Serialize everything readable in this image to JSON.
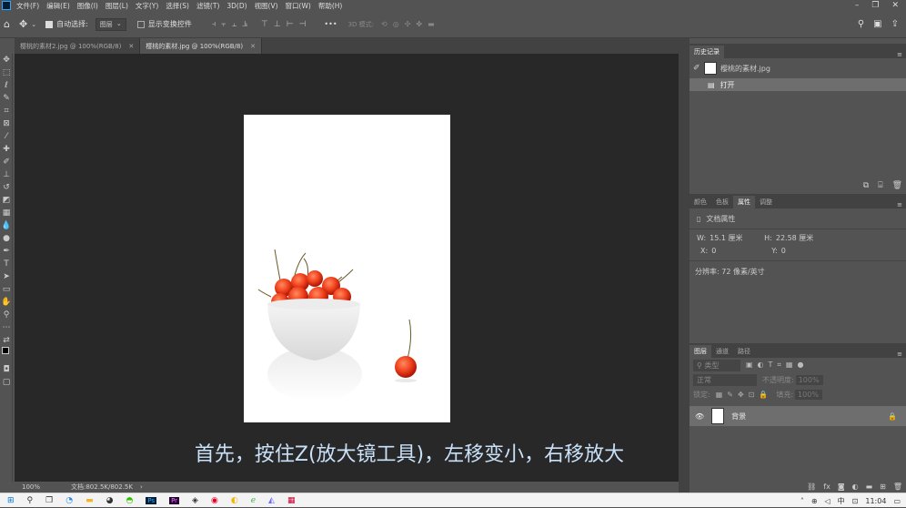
{
  "menu": [
    "文件(F)",
    "编辑(E)",
    "图像(I)",
    "图层(L)",
    "文字(Y)",
    "选择(S)",
    "滤镜(T)",
    "3D(D)",
    "视图(V)",
    "窗口(W)",
    "帮助(H)"
  ],
  "options": {
    "auto_select_label": "自动选择:",
    "auto_select_value": "图层",
    "show_transform_label": "显示变换控件",
    "mode_3d": "3D 模式:"
  },
  "doc_tabs": [
    {
      "label": "樱桃的素材2.jpg @ 100%(RGB/8)",
      "active": false
    },
    {
      "label": "樱桃的素材.jpg @ 100%(RGB/8)",
      "active": true
    }
  ],
  "caption": "首先，按住Z(放大镜工具)，左移变小，右移放大",
  "status": {
    "zoom": "100%",
    "doc_info": "文档:802.5K/802.5K"
  },
  "history": {
    "title": "历史记录",
    "snapshot": "樱桃的素材.jpg",
    "items": [
      "打开"
    ]
  },
  "properties": {
    "tabs": [
      "颜色",
      "色板",
      "属性",
      "调整"
    ],
    "active_tab": "属性",
    "section": "文档属性",
    "w_label": "W:",
    "w_value": "15.1 厘米",
    "h_label": "H:",
    "h_value": "22.58 厘米",
    "x_label": "X:",
    "x_value": "0",
    "y_label": "Y:",
    "y_value": "0",
    "resolution": "分辨率: 72 像素/英寸"
  },
  "layers": {
    "tabs": [
      "图层",
      "通道",
      "路径"
    ],
    "kind": "类型",
    "blend": "正常",
    "opacity_label": "不透明度:",
    "opacity_value": "100%",
    "lock_label": "锁定:",
    "fill_label": "填充:",
    "fill_value": "100%",
    "items": [
      {
        "name": "背景"
      }
    ]
  },
  "taskbar": {
    "time": "11:04",
    "ime": "中"
  },
  "colors": {
    "accent": "#31a8ff",
    "panel": "#535353",
    "canvas": "#282828"
  }
}
